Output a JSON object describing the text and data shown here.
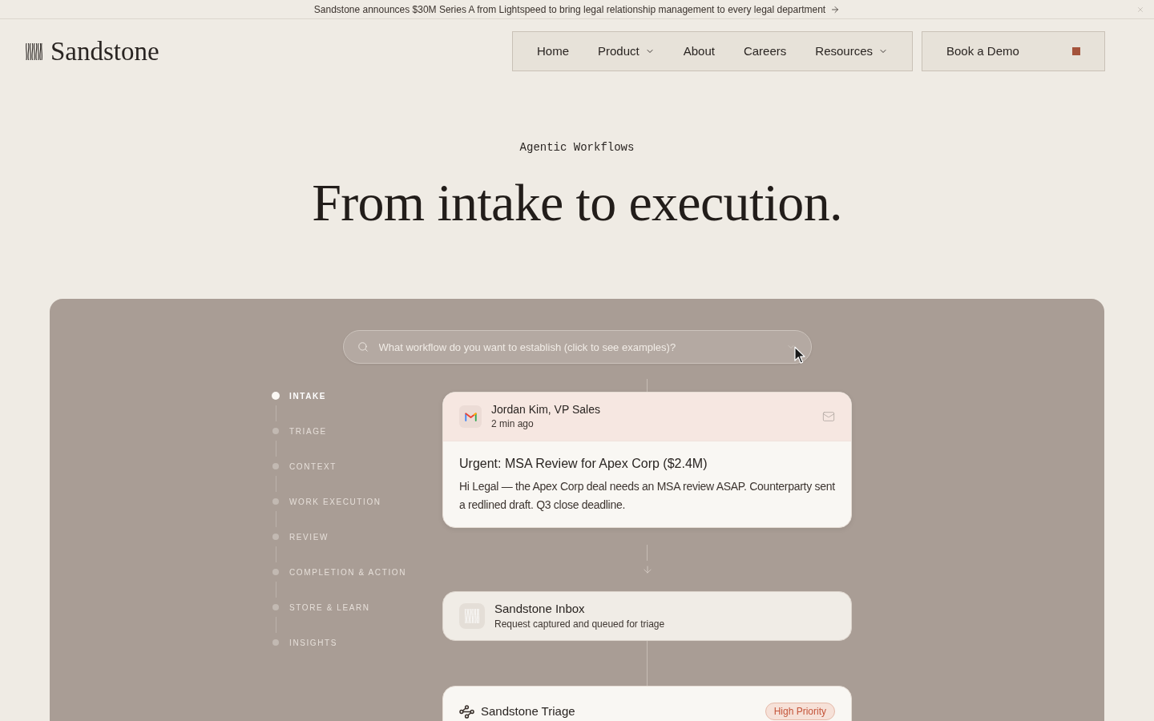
{
  "announcement": {
    "text": "Sandstone announces $30M Series A from Lightspeed to bring legal relationship management to every legal department"
  },
  "header": {
    "logo": "Sandstone",
    "nav": [
      {
        "label": "Home",
        "dropdown": false
      },
      {
        "label": "Product",
        "dropdown": true
      },
      {
        "label": "About",
        "dropdown": false
      },
      {
        "label": "Careers",
        "dropdown": false
      },
      {
        "label": "Resources",
        "dropdown": true
      }
    ],
    "cta": "Book a Demo"
  },
  "hero": {
    "eyebrow": "Agentic Workflows",
    "headline": "From intake to execution."
  },
  "demo": {
    "search": {
      "placeholder": "What workflow do you want to establish (click to see examples)?"
    },
    "steps": [
      {
        "label": "INTAKE",
        "selected": true
      },
      {
        "label": "TRIAGE",
        "selected": false
      },
      {
        "label": "CONTEXT",
        "selected": false
      },
      {
        "label": "WORK EXECUTION",
        "selected": false
      },
      {
        "label": "REVIEW",
        "selected": false
      },
      {
        "label": "COMPLETION & ACTION",
        "selected": false
      },
      {
        "label": "STORE & LEARN",
        "selected": false
      },
      {
        "label": "INSIGHTS",
        "selected": false
      }
    ],
    "flow": [
      {
        "kind": "email",
        "sender": "Jordan Kim, VP Sales",
        "time": "2 min ago",
        "subject": "Urgent: MSA Review for Apex Corp ($2.4M)",
        "body": "Hi Legal — the Apex Corp deal needs an MSA review ASAP. Counterparty sent a redlined draft. Q3 close deadline."
      },
      {
        "kind": "system",
        "title": "Sandstone Inbox",
        "subtitle": "Request captured and queued for triage"
      },
      {
        "kind": "triage",
        "title": "Sandstone Triage",
        "badge": "High Priority"
      }
    ]
  }
}
